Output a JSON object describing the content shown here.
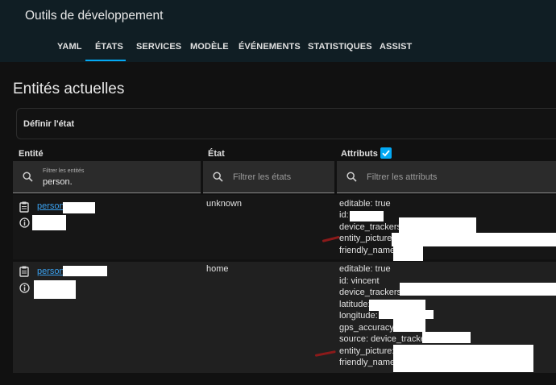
{
  "header": {
    "title": "Outils de développement",
    "tabs": [
      {
        "label": "YAML"
      },
      {
        "label": "ÉTATS",
        "active": true
      },
      {
        "label": "SERVICES"
      },
      {
        "label": "MODÈLE"
      },
      {
        "label": "ÉVÉNEMENTS"
      },
      {
        "label": "STATISTIQUES"
      },
      {
        "label": "ASSIST"
      }
    ]
  },
  "page": {
    "title": "Entités actuelles",
    "set_state_label": "Définir l'état"
  },
  "table": {
    "columns": {
      "entity": "Entité",
      "state": "État",
      "attributes": "Attributs"
    },
    "attributes_checked": true,
    "filters": {
      "entity_label": "Filtrer les entités",
      "entity_value": "person.",
      "state_placeholder": "Filtrer les états",
      "attributes_placeholder": "Filtrer les attributs"
    },
    "rows": [
      {
        "entity": "person.",
        "state": "unknown",
        "attributes": [
          "editable: true",
          "id:",
          "device_trackers:",
          "entity_picture:",
          "friendly_name:"
        ]
      },
      {
        "entity": "person.",
        "state": "home",
        "attributes": [
          "editable: true",
          "id: vincent",
          "device_trackers:",
          "latitude:",
          "longitude:",
          "gps_accuracy:",
          "source: device_tracker.",
          "entity_picture: /",
          "friendly_name:"
        ]
      }
    ]
  },
  "colors": {
    "accent": "#03a9f4",
    "header_bg": "#101e24",
    "link": "#3aa0ee"
  }
}
